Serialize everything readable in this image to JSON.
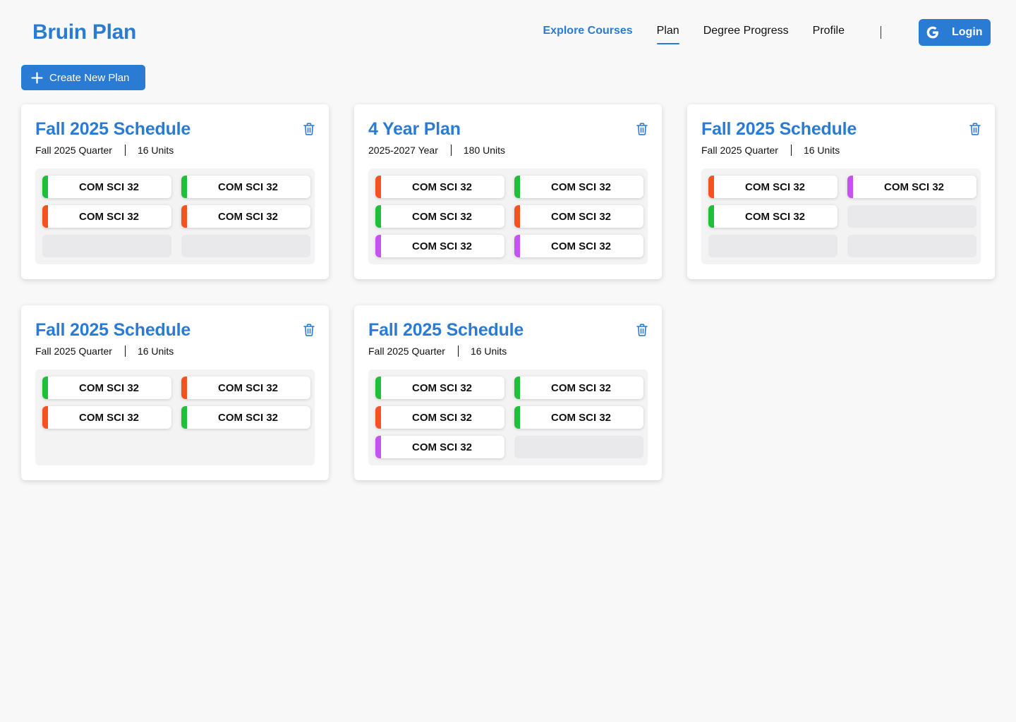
{
  "header": {
    "brand": "Bruin Plan",
    "nav": [
      {
        "label": "Explore Courses"
      },
      {
        "label": "Plan"
      },
      {
        "label": "Degree Progress"
      },
      {
        "label": "Profile"
      }
    ],
    "separator": "|",
    "login_label": "Login"
  },
  "toolbar": {
    "create_label": "Create New Plan"
  },
  "colors": {
    "accent": "#2a7bd3",
    "green": "#1fbf3a",
    "orange": "#f5521f",
    "purple": "#c553f0"
  },
  "plans": [
    {
      "title": "Fall 2025 Schedule",
      "period": "Fall 2025 Quarter",
      "units": "16 Units",
      "courses": [
        {
          "name": "COM SCI 32",
          "color": "#1fbf3a"
        },
        {
          "name": "COM SCI 32",
          "color": "#1fbf3a"
        },
        {
          "name": "COM SCI 32",
          "color": "#f5521f"
        },
        {
          "name": "COM SCI 32",
          "color": "#f5521f"
        }
      ],
      "empty_slots": 2
    },
    {
      "title": "4 Year Plan",
      "period": "2025-2027 Year",
      "units": "180 Units",
      "courses": [
        {
          "name": "COM SCI 32",
          "color": "#f5521f"
        },
        {
          "name": "COM SCI 32",
          "color": "#1fbf3a"
        },
        {
          "name": "COM SCI 32",
          "color": "#1fbf3a"
        },
        {
          "name": "COM SCI 32",
          "color": "#f5521f"
        },
        {
          "name": "COM SCI 32",
          "color": "#c553f0"
        },
        {
          "name": "COM SCI 32",
          "color": "#c553f0"
        }
      ],
      "empty_slots": 0
    },
    {
      "title": "Fall 2025 Schedule",
      "period": "Fall 2025 Quarter",
      "units": "16 Units",
      "courses": [
        {
          "name": "COM SCI 32",
          "color": "#f5521f"
        },
        {
          "name": "COM SCI 32",
          "color": "#c553f0"
        },
        {
          "name": "COM SCI 32",
          "color": "#1fbf3a"
        }
      ],
      "empty_slots": 3
    },
    {
      "title": "Fall 2025 Schedule",
      "period": "Fall 2025 Quarter",
      "units": "16 Units",
      "courses": [
        {
          "name": "COM SCI 32",
          "color": "#1fbf3a"
        },
        {
          "name": "COM SCI 32",
          "color": "#f5521f"
        },
        {
          "name": "COM SCI 32",
          "color": "#f5521f"
        },
        {
          "name": "COM SCI 32",
          "color": "#1fbf3a"
        }
      ],
      "empty_slots": 0
    },
    {
      "title": "Fall 2025 Schedule",
      "period": "Fall 2025 Quarter",
      "units": "16 Units",
      "courses": [
        {
          "name": "COM SCI 32",
          "color": "#1fbf3a"
        },
        {
          "name": "COM SCI 32",
          "color": "#1fbf3a"
        },
        {
          "name": "COM SCI 32",
          "color": "#f5521f"
        },
        {
          "name": "COM SCI 32",
          "color": "#1fbf3a"
        },
        {
          "name": "COM SCI 32",
          "color": "#c553f0"
        }
      ],
      "empty_slots": 1
    }
  ]
}
